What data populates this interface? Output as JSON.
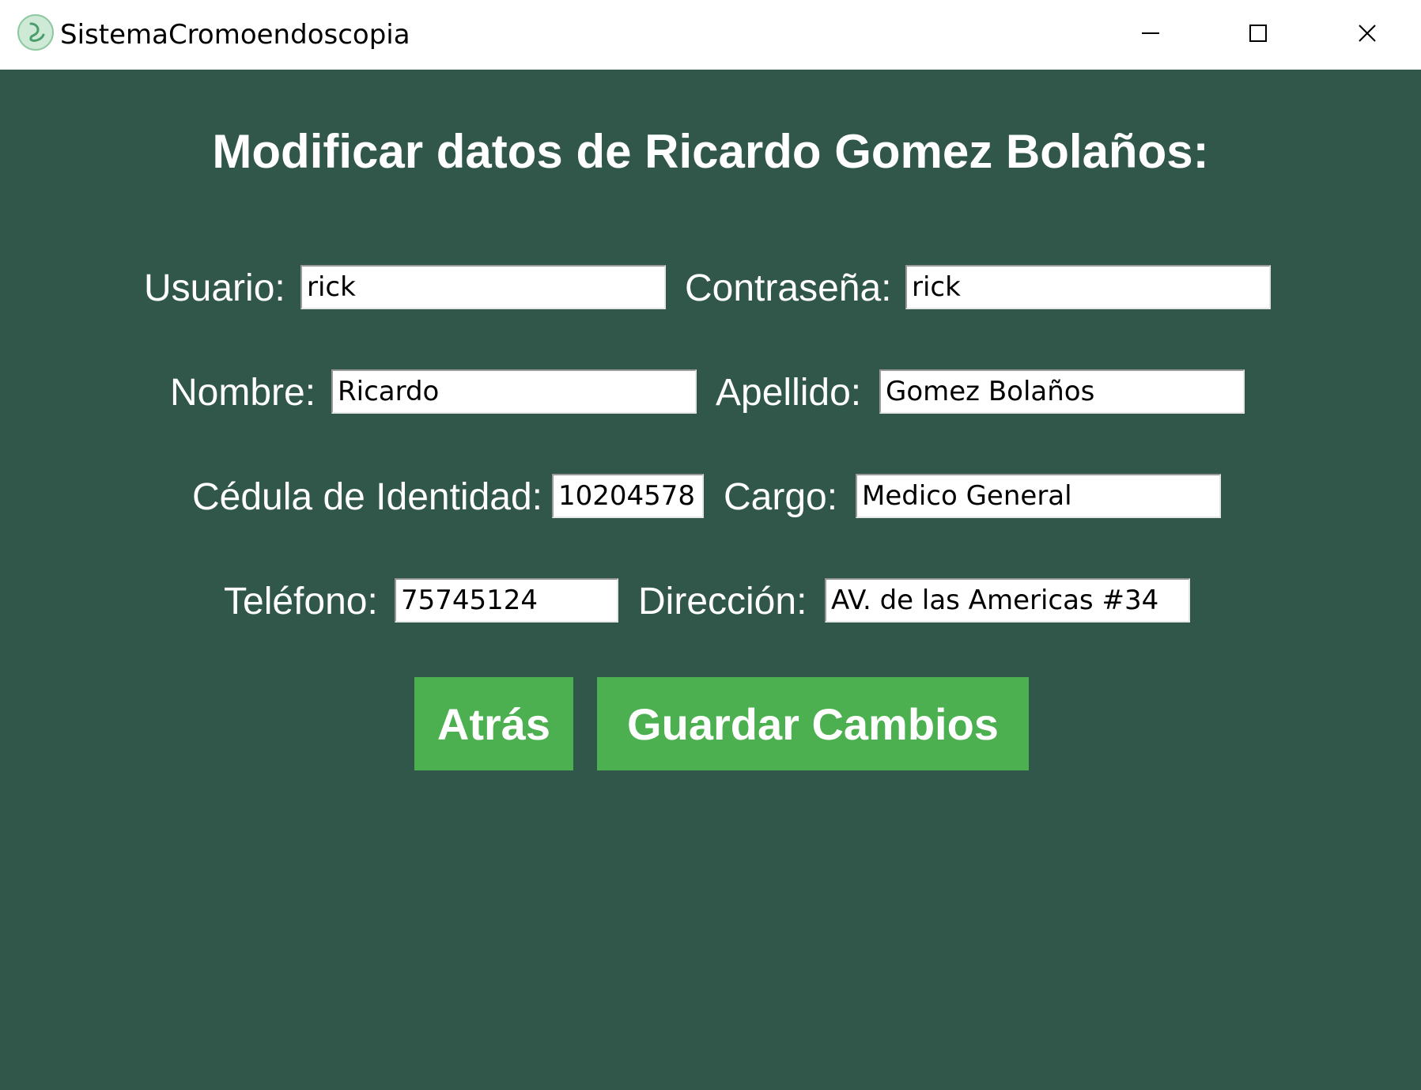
{
  "window": {
    "title": "SistemaCromoendoscopia",
    "controls": {
      "minimize": "minimize-icon",
      "maximize": "maximize-icon",
      "close": "close-icon"
    }
  },
  "colors": {
    "background": "#31574a",
    "button": "#4cb050",
    "text": "#ffffff"
  },
  "form": {
    "heading": "Modificar datos de Ricardo Gomez Bolaños:",
    "fields": {
      "usuario": {
        "label": "Usuario:",
        "value": "rick"
      },
      "contrasena": {
        "label": "Contraseña:",
        "value": "rick"
      },
      "nombre": {
        "label": "Nombre:",
        "value": "Ricardo"
      },
      "apellido": {
        "label": "Apellido:",
        "value": "Gomez Bolaños"
      },
      "cedula": {
        "label": "Cédula de Identidad:",
        "value": "10204578"
      },
      "cargo": {
        "label": "Cargo:",
        "value": "Medico General"
      },
      "telefono": {
        "label": "Teléfono:",
        "value": "75745124"
      },
      "direccion": {
        "label": "Dirección:",
        "value": "AV. de las Americas #34"
      }
    },
    "buttons": {
      "back": "Atrás",
      "save": "Guardar Cambios"
    }
  }
}
